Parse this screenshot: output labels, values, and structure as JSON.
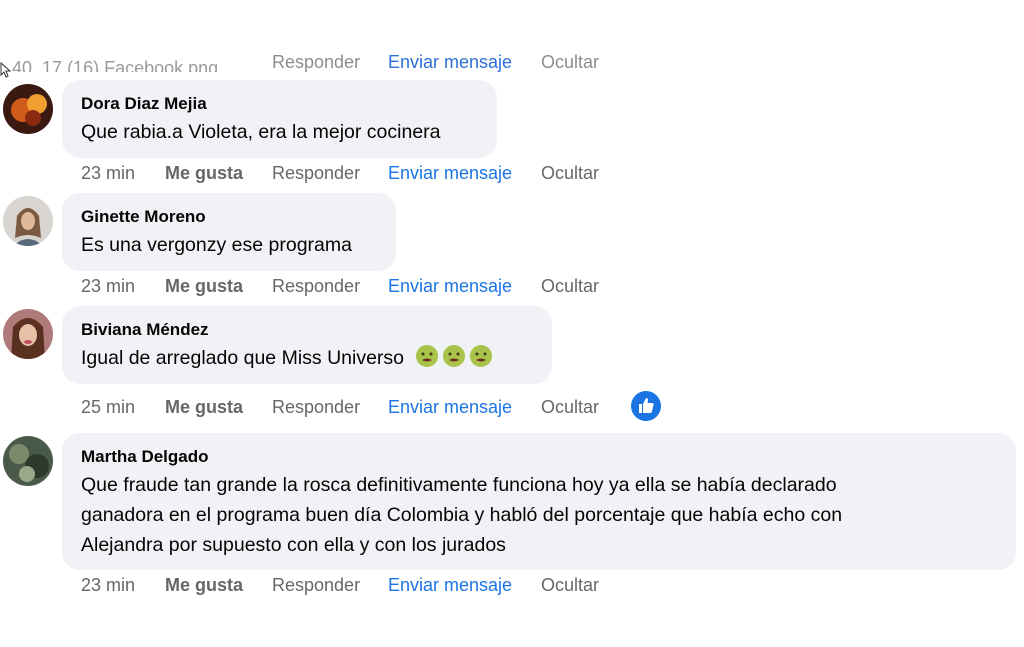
{
  "cutoff_row": {
    "filename": "_40_17 (16) Facebook.png",
    "reply": "Responder",
    "send": "Enviar mensaje",
    "hide": "Ocultar"
  },
  "comments": [
    {
      "author": "Dora Diaz Mejia",
      "text": "Que rabia.a Violeta, era la mejor cocinera",
      "time": "23 min",
      "like": "Me gusta",
      "reply": "Responder",
      "send": "Enviar mensaje",
      "hide": "Ocultar"
    },
    {
      "author": "Ginette Moreno",
      "text": "Es una vergonzy ese programa",
      "time": "23 min",
      "like": "Me gusta",
      "reply": "Responder",
      "send": "Enviar mensaje",
      "hide": "Ocultar"
    },
    {
      "author": "Biviana Méndez",
      "text": "Igual de arreglado que Miss Universo",
      "emojis": [
        "nauseated-face",
        "nauseated-face",
        "nauseated-face"
      ],
      "time": "25 min",
      "like": "Me gusta",
      "reply": "Responder",
      "send": "Enviar mensaje",
      "hide": "Ocultar",
      "reaction": "like-icon"
    },
    {
      "author": "Martha Delgado",
      "text_lines": [
        "Que fraude tan grande la rosca definitivamente funciona hoy ya ella se había declarado",
        "ganadora en el programa buen día Colombia y habló del porcentaje que había echo con",
        "Alejandra por supuesto con ella y con los jurados"
      ],
      "time": "23 min",
      "like": "Me gusta",
      "reply": "Responder",
      "send": "Enviar mensaje",
      "hide": "Ocultar"
    }
  ],
  "colors": {
    "bubble": "#f0f2f5",
    "meta": "#65676b",
    "link": "#1b74e4"
  }
}
